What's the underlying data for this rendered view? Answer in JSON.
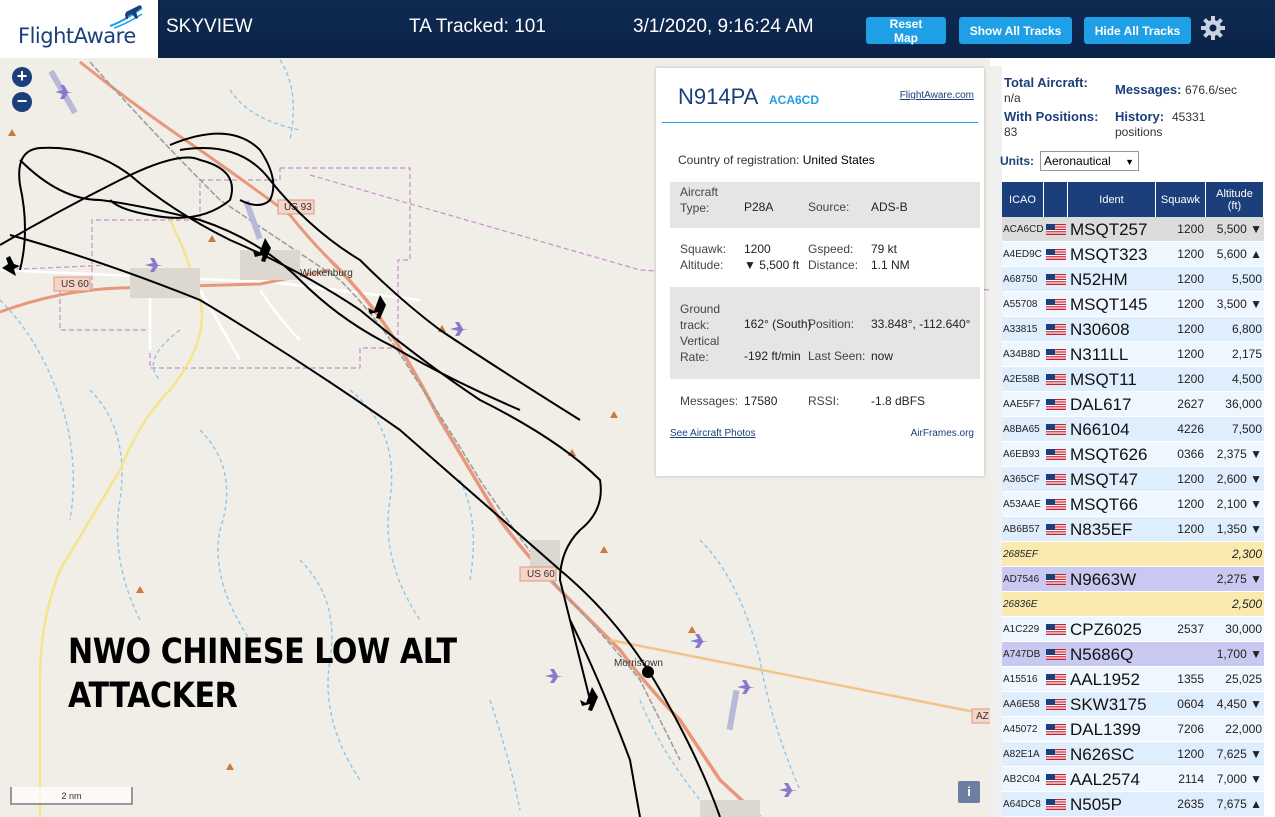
{
  "header": {
    "logo_text": "FlightAware",
    "app_name": "SKYVIEW",
    "ta_tracked": "TA Tracked: 101",
    "clock": "3/1/2020, 9:16:24 AM",
    "buttons": {
      "reset": "Reset Map",
      "show_all": "Show All Tracks",
      "hide_all": "Hide All Tracks"
    }
  },
  "map": {
    "zoom_in": "+",
    "zoom_out": "−",
    "roads": [
      "US 93",
      "US 60",
      "US 60",
      "AZ"
    ],
    "towns": [
      "Wickenburg",
      "Morristown"
    ],
    "caption_line1": "NWO CHINESE LOW ALT",
    "caption_line2": "ATTACKER",
    "scale": "2 nm",
    "info_button": "i"
  },
  "aircraft_card": {
    "registration": "N914PA",
    "icao": "ACA6CD",
    "fa_link": "FlightAware.com",
    "country_label": "Country of registration:",
    "country_value": "United States",
    "aircraft_type_label": "Aircraft Type:",
    "aircraft_type_value": "P28A",
    "source_label": "Source:",
    "source_value": "ADS-B",
    "squawk_label": "Squawk:",
    "squawk_value": "1200",
    "gspeed_label": "Gspeed:",
    "gspeed_value": "79 kt",
    "altitude_label": "Altitude:",
    "altitude_value": "▼ 5,500 ft",
    "distance_label": "Distance:",
    "distance_value": "1.1 NM",
    "ground_track_label": "Ground track:",
    "ground_track_value": "162° (South)",
    "position_label": "Position:",
    "position_value": "33.848°, -112.640°",
    "vertical_rate_label": "Vertical Rate:",
    "vertical_rate_value": "-192 ft/min",
    "last_seen_label": "Last Seen:",
    "last_seen_value": "now",
    "messages_label": "Messages:",
    "messages_value": "17580",
    "rssi_label": "RSSI:",
    "rssi_value": "-1.8 dBFS",
    "photos_link": "See Aircraft Photos",
    "airframes_link": "AirFrames.org"
  },
  "stats": {
    "total_aircraft_label": "Total Aircraft:",
    "total_aircraft_value": "n/a",
    "messages_label": "Messages:",
    "messages_value": "676.6/sec",
    "with_positions_label": "With Positions:",
    "with_positions_value": "83",
    "history_label": "History:",
    "history_value": "45331",
    "history_unit": "positions",
    "units_label": "Units:",
    "units_value": "Aeronautical"
  },
  "table": {
    "headers": {
      "icao": "ICAO",
      "ident": "Ident",
      "squawk": "Squawk",
      "altitude": "Altitude",
      "altitude_unit": "(ft)"
    },
    "rows": [
      {
        "icao": "ACA6CD",
        "flag": true,
        "ident": "MSQT257",
        "squawk": "1200",
        "alt": "5,500 ▼",
        "kind": "sel"
      },
      {
        "icao": "A4ED9C",
        "flag": true,
        "ident": "MSQT323",
        "squawk": "1200",
        "alt": "5,600 ▲",
        "kind": "even"
      },
      {
        "icao": "A68750",
        "flag": true,
        "ident": "N52HM",
        "squawk": "1200",
        "alt": "5,500",
        "kind": "odd"
      },
      {
        "icao": "A55708",
        "flag": true,
        "ident": "MSQT145",
        "squawk": "1200",
        "alt": "3,500 ▼",
        "kind": "even"
      },
      {
        "icao": "A33815",
        "flag": true,
        "ident": "N30608",
        "squawk": "1200",
        "alt": "6,800",
        "kind": "odd"
      },
      {
        "icao": "A34B8D",
        "flag": true,
        "ident": "N311LL",
        "squawk": "1200",
        "alt": "2,175",
        "kind": "even"
      },
      {
        "icao": "A2E58B",
        "flag": true,
        "ident": "MSQT11",
        "squawk": "1200",
        "alt": "4,500",
        "kind": "odd"
      },
      {
        "icao": "AAE5F7",
        "flag": true,
        "ident": "DAL617",
        "squawk": "2627",
        "alt": "36,000",
        "kind": "even"
      },
      {
        "icao": "A8BA65",
        "flag": true,
        "ident": "N66104",
        "squawk": "4226",
        "alt": "7,500",
        "kind": "odd"
      },
      {
        "icao": "A6EB93",
        "flag": true,
        "ident": "MSQT626",
        "squawk": "0366",
        "alt": "2,375 ▼",
        "kind": "even"
      },
      {
        "icao": "A365CF",
        "flag": true,
        "ident": "MSQT47",
        "squawk": "1200",
        "alt": "2,600 ▼",
        "kind": "odd"
      },
      {
        "icao": "A53AAE",
        "flag": true,
        "ident": "MSQT66",
        "squawk": "1200",
        "alt": "2,100 ▼",
        "kind": "even"
      },
      {
        "icao": "AB6B57",
        "flag": true,
        "ident": "N835EF",
        "squawk": "1200",
        "alt": "1,350 ▼",
        "kind": "odd"
      },
      {
        "icao": "2685EF",
        "flag": false,
        "ident": "",
        "squawk": "",
        "alt": "2,300",
        "kind": "noposn"
      },
      {
        "icao": "AD7546",
        "flag": true,
        "ident": "N9663W",
        "squawk": "",
        "alt": "2,275 ▼",
        "kind": "mlat"
      },
      {
        "icao": "26836E",
        "flag": false,
        "ident": "",
        "squawk": "",
        "alt": "2,500",
        "kind": "noposn"
      },
      {
        "icao": "A1C229",
        "flag": true,
        "ident": "CPZ6025",
        "squawk": "2537",
        "alt": "30,000",
        "kind": "even"
      },
      {
        "icao": "A747DB",
        "flag": true,
        "ident": "N5686Q",
        "squawk": "",
        "alt": "1,700 ▼",
        "kind": "mlat"
      },
      {
        "icao": "A15516",
        "flag": true,
        "ident": "AAL1952",
        "squawk": "1355",
        "alt": "25,025",
        "kind": "even"
      },
      {
        "icao": "AA6E58",
        "flag": true,
        "ident": "SKW3175",
        "squawk": "0604",
        "alt": "4,450 ▼",
        "kind": "odd"
      },
      {
        "icao": "A45072",
        "flag": true,
        "ident": "DAL1399",
        "squawk": "7206",
        "alt": "22,000",
        "kind": "even"
      },
      {
        "icao": "A82E1A",
        "flag": true,
        "ident": "N626SC",
        "squawk": "1200",
        "alt": "7,625 ▼",
        "kind": "odd"
      },
      {
        "icao": "AB2C04",
        "flag": true,
        "ident": "AAL2574",
        "squawk": "2114",
        "alt": "7,000 ▼",
        "kind": "even"
      },
      {
        "icao": "A64DC8",
        "flag": true,
        "ident": "N505P",
        "squawk": "2635",
        "alt": "7,675 ▲",
        "kind": "odd"
      }
    ]
  },
  "colors": {
    "header_bg": "#0a2247",
    "brand_blue": "#1b3f7a",
    "button_blue": "#1e9fe6",
    "road_orange": "#e8987a",
    "track_black": "#000000"
  }
}
